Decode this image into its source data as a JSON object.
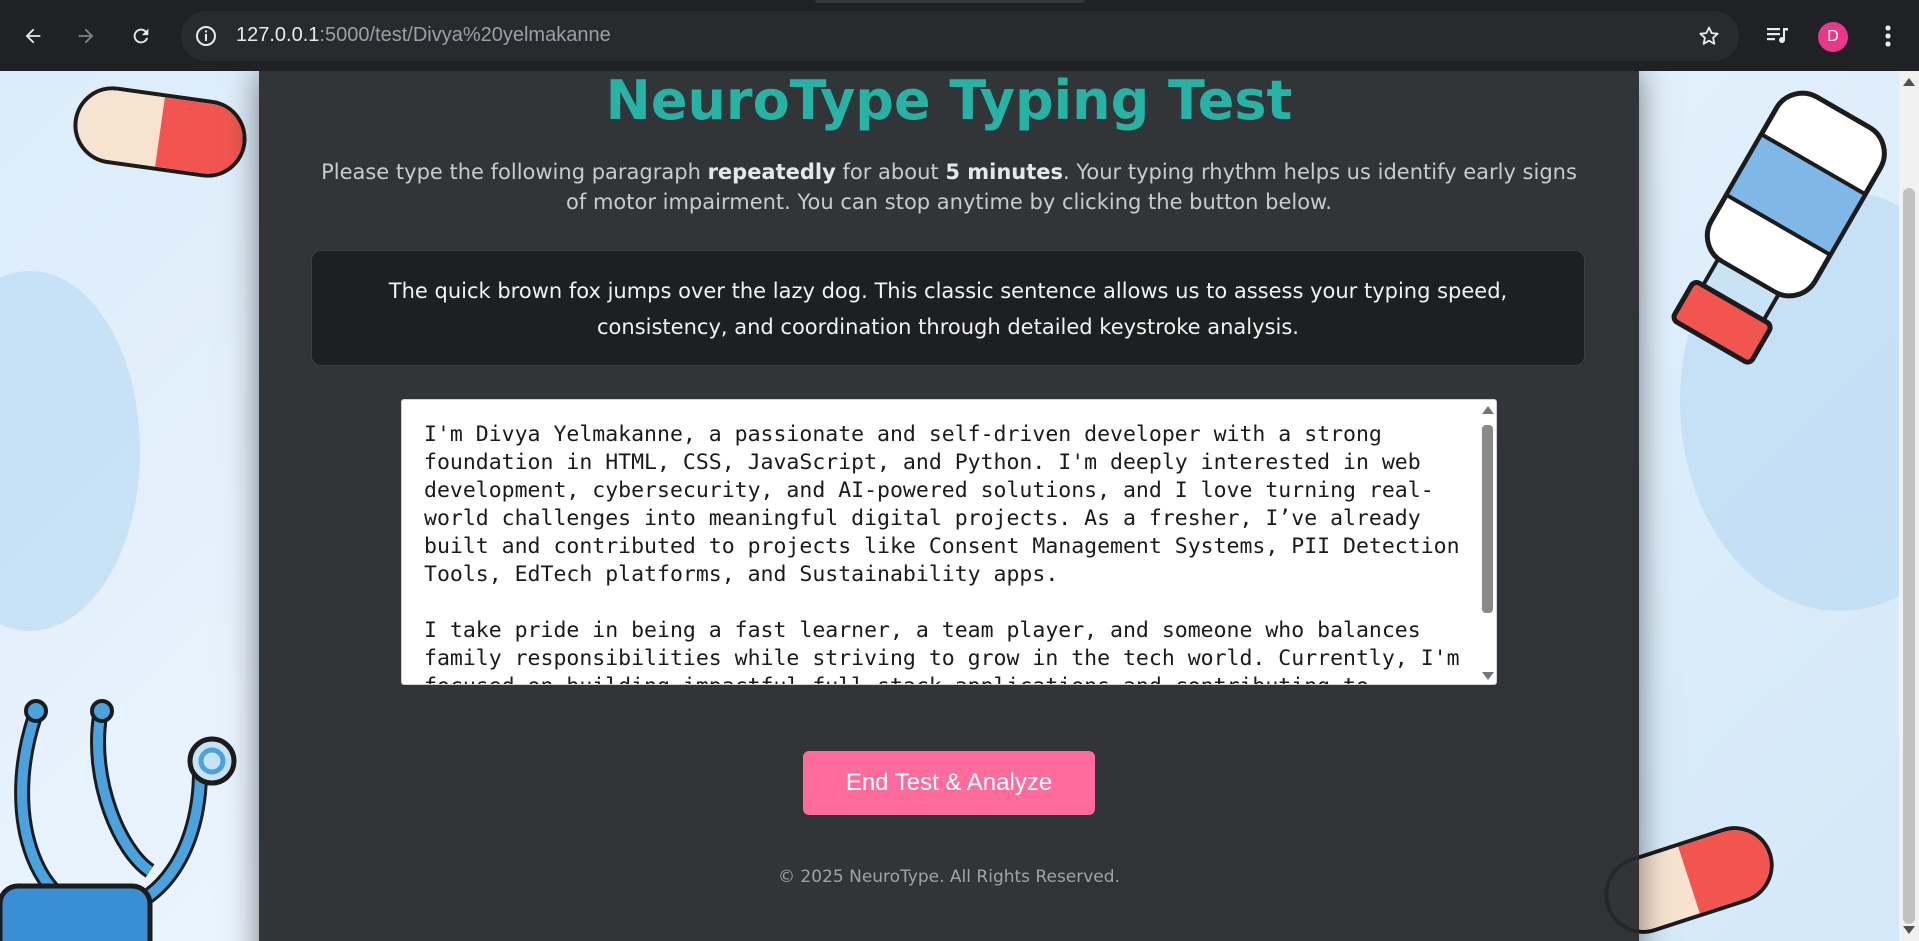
{
  "browser": {
    "url_host": "127.0.0.1",
    "url_path": ":5000/test/Divya%20yelmakanne",
    "avatar_letter": "D",
    "accent_avatar": "#e8388b"
  },
  "page": {
    "title": "NeuroType Typing Test",
    "instructions": {
      "part1": "Please type the following paragraph ",
      "bold1": "repeatedly",
      "part2": " for about ",
      "bold2": "5 minutes",
      "part3": ". Your typing rhythm helps us identify early signs of motor impairment. You can stop anytime by clicking the button below."
    },
    "sample_paragraph": "The quick brown fox jumps over the lazy dog. This classic sentence allows us to assess your typing speed, consistency, and coordination through detailed keystroke analysis.",
    "typed_text": "I'm Divya Yelmakanne, a passionate and self-driven developer with a strong foundation in HTML, CSS, JavaScript, and Python. I'm deeply interested in web development, cybersecurity, and AI-powered solutions, and I love turning real-world challenges into meaningful digital projects. As a fresher, I’ve already built and contributed to projects like Consent Management Systems, PII Detection Tools, EdTech platforms, and Sustainability apps.\n\nI take pride in being a fast learner, a team player, and someone who balances family responsibilities while striving to grow in the tech world. Currently, I'm focused on building impactful full-stack applications and contributing to",
    "end_button_label": "End Test & Analyze",
    "footer": "© 2025 NeuroType. All Rights Reserved.",
    "colors": {
      "title": "#26b3a5",
      "button": "#ff6b9d",
      "card": "#26282a"
    }
  }
}
